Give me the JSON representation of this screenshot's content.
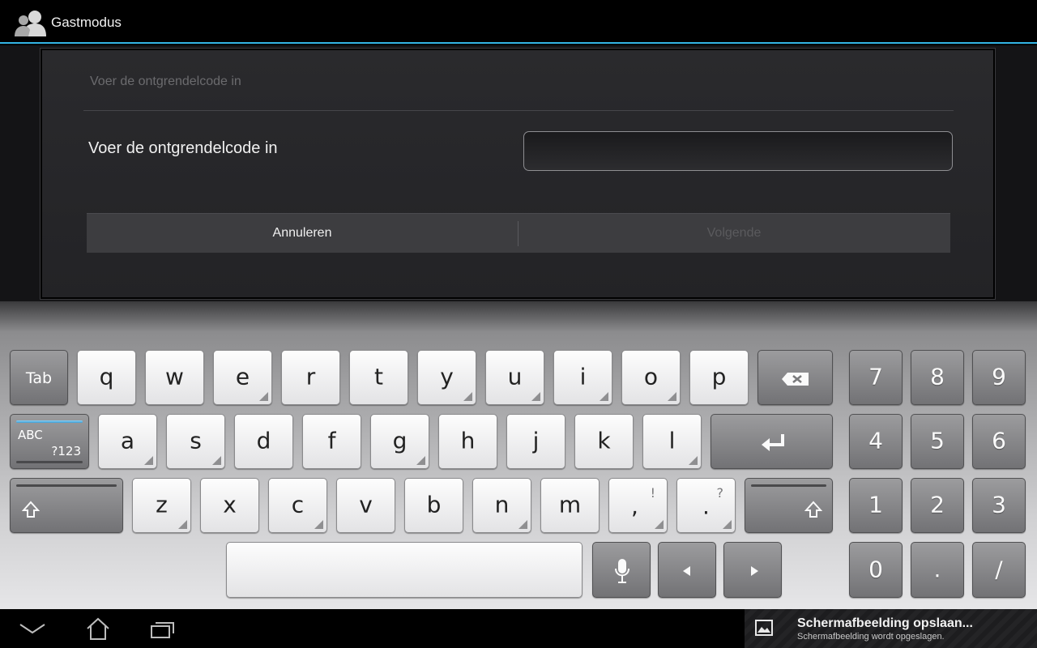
{
  "titlebar": {
    "title": "Gastmodus",
    "icon": "user-silhouette-icon"
  },
  "dialog": {
    "title": "Voer de ontgrendelcode in",
    "field_label": "Voer de ontgrendelcode in",
    "field_value": "",
    "cancel_label": "Annuleren",
    "next_label": "Volgende",
    "next_enabled": false
  },
  "keyboard": {
    "row1": [
      "q",
      "w",
      "e",
      "r",
      "t",
      "y",
      "u",
      "i",
      "o",
      "p"
    ],
    "row2": [
      "a",
      "s",
      "d",
      "f",
      "g",
      "h",
      "j",
      "k",
      "l"
    ],
    "row3": [
      "z",
      "x",
      "c",
      "v",
      "b",
      "n",
      "m",
      ",",
      "."
    ],
    "row3_alts": [
      "!",
      "?"
    ],
    "tab_label": "Tab",
    "mode_label_top": "ABC",
    "mode_label_bottom": "?123",
    "numpad": [
      "7",
      "8",
      "9",
      "4",
      "5",
      "6",
      "1",
      "2",
      "3",
      "0",
      ".",
      "/"
    ]
  },
  "notification": {
    "title": "Schermafbeelding opslaan...",
    "subtitle": "Schermafbeelding wordt opgeslagen.",
    "icon": "image-icon"
  },
  "navbar": {
    "icons": [
      "back-icon",
      "home-icon",
      "recent-apps-icon"
    ]
  },
  "colors": {
    "accent": "#33b5e5"
  }
}
